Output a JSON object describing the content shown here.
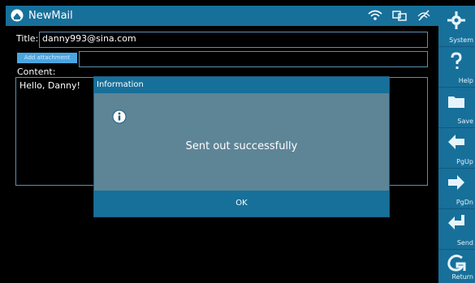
{
  "app": {
    "title": "NewMail",
    "icons": [
      "mail-icon",
      "wifi-icon",
      "network-icon",
      "signal-icon"
    ]
  },
  "form": {
    "title_label": "Title:",
    "title_value": "danny993@sina.com",
    "attachment_button": "Add attachment",
    "content_label": "Content:",
    "content_value": "Hello,  Danny!"
  },
  "dialog": {
    "title": "Information",
    "message": "Sent out successfully",
    "ok_label": "OK",
    "icon": "info-icon"
  },
  "sidebar": {
    "items": [
      {
        "label": "System",
        "icon": "gear-icon"
      },
      {
        "label": "Help",
        "icon": "question-icon"
      },
      {
        "label": "Save",
        "icon": "folder-icon"
      },
      {
        "label": "PgUp",
        "icon": "arrow-left-icon"
      },
      {
        "label": "PgDn",
        "icon": "arrow-right-icon"
      },
      {
        "label": "Send",
        "icon": "return-arrow-icon"
      },
      {
        "label": "Return",
        "icon": "return-icon"
      }
    ]
  },
  "colors": {
    "titlebar": "#17709a",
    "dialog_body": "#5e8596",
    "border": "#5a8fb0",
    "accent": "#4aa6e0"
  }
}
